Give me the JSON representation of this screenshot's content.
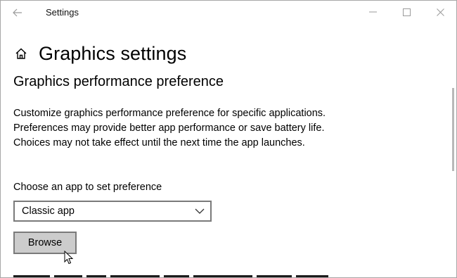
{
  "window": {
    "title": "Settings"
  },
  "icons": {
    "back": "back-arrow-icon",
    "minimize": "minimize-icon",
    "maximize": "maximize-icon",
    "close": "close-icon",
    "home": "home-icon",
    "dropdown": "chevron-down-icon",
    "cursor": "mouse-pointer-icon"
  },
  "page": {
    "title": "Graphics settings",
    "section_title": "Graphics performance preference",
    "description": "Customize graphics performance preference for specific applications. Preferences may provide better app performance or save battery life. Choices may not take effect until the next time the app launches.",
    "choose_label": "Choose an app to set preference",
    "dropdown_value": "Classic app",
    "browse_label": "Browse"
  }
}
